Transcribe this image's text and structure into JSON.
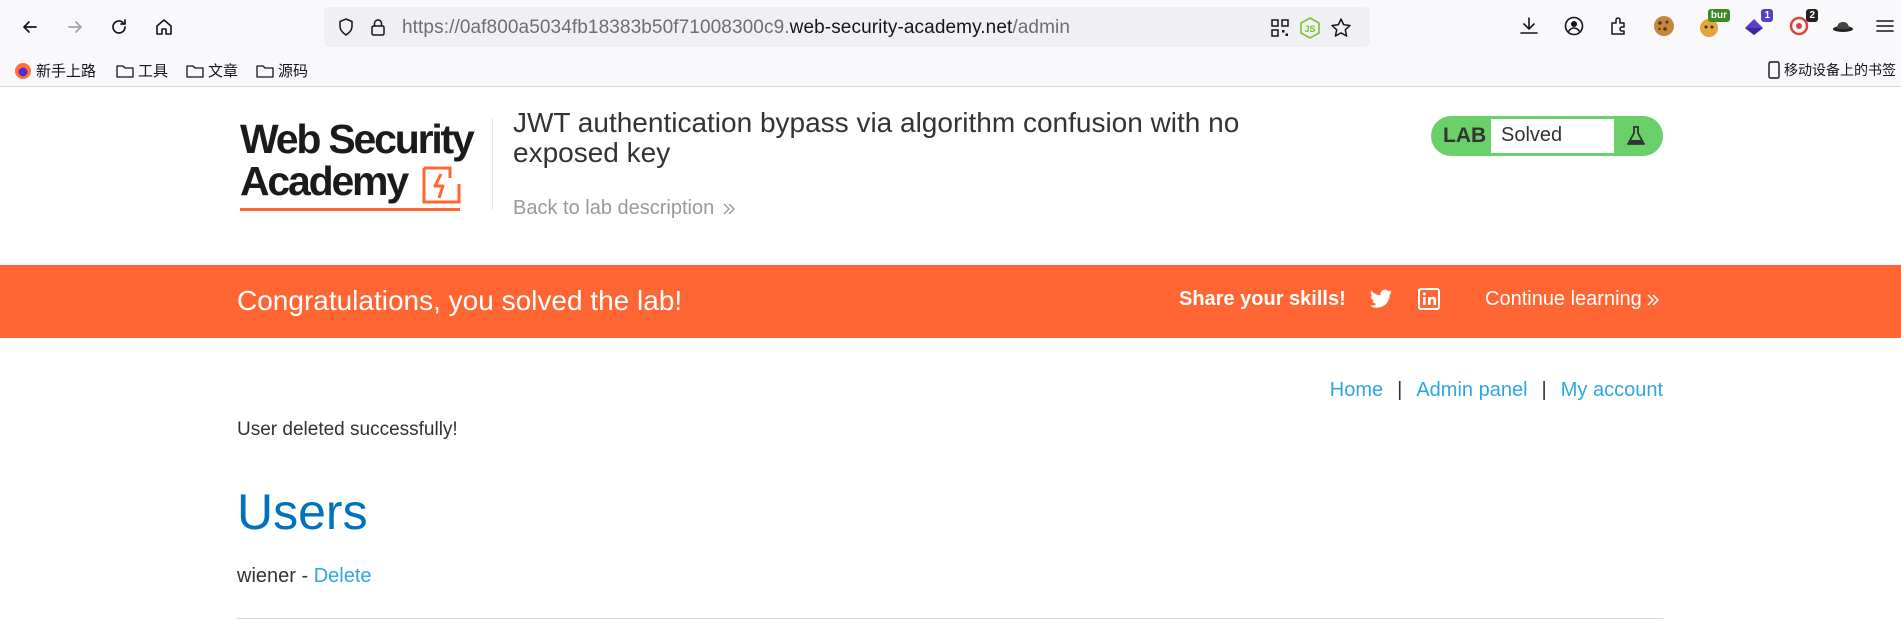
{
  "browser": {
    "url_prefix": "https://0af800a5034fb18383b50f71008300c9.",
    "url_host": "web-security-academy.net",
    "url_path": "/admin",
    "extensions": [
      {
        "name": "cookie-icon",
        "badge": ""
      },
      {
        "name": "burp-icon",
        "badge": "bur"
      },
      {
        "name": "purple-ext-icon",
        "badge": "1"
      },
      {
        "name": "red-ext-icon",
        "badge": "2"
      },
      {
        "name": "hat-icon",
        "badge": ""
      }
    ],
    "bookmarks": [
      {
        "label": "新手上路",
        "icon": "firefox-icon"
      },
      {
        "label": "工具",
        "icon": "folder-icon"
      },
      {
        "label": "文章",
        "icon": "folder-icon"
      },
      {
        "label": "源码",
        "icon": "folder-icon"
      }
    ],
    "mobile_bookmarks": "移动设备上的书签"
  },
  "header": {
    "brand_line1": "Web Security",
    "brand_line2": "Academy",
    "lab_title": "JWT authentication bypass via algorithm confusion with no exposed key",
    "back_link": "Back to lab description",
    "lab_label": "LAB",
    "status": "Solved"
  },
  "banner": {
    "message": "Congratulations, you solved the lab!",
    "share": "Share your skills!",
    "continue": "Continue learning"
  },
  "nav": {
    "home": "Home",
    "admin_panel": "Admin panel",
    "my_account": "My account",
    "separator": "|"
  },
  "content": {
    "flash": "User deleted successfully!",
    "heading": "Users",
    "users": [
      {
        "name": "wiener",
        "separator": " - ",
        "action": "Delete"
      }
    ]
  },
  "colors": {
    "accent_orange": "#ff6633",
    "solved_green": "#6ad06a",
    "link_blue": "#2da7e2",
    "heading_blue": "#0071bc"
  }
}
